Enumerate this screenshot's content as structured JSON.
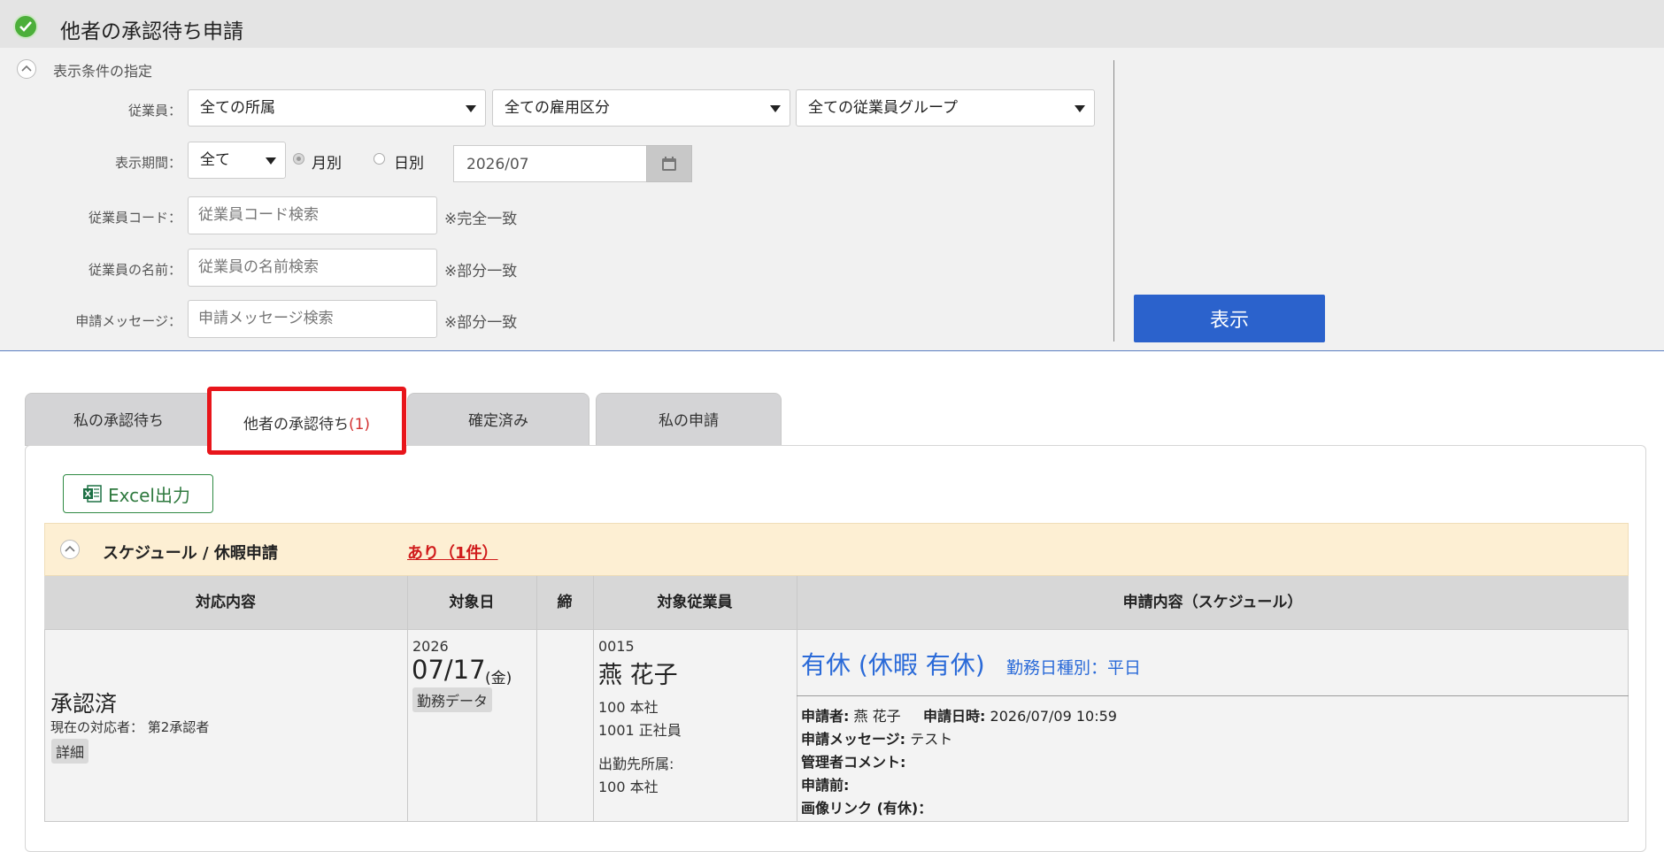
{
  "header": {
    "title": "他者の承認待ち申請",
    "icon": "check-circle-icon"
  },
  "filter": {
    "section_label": "表示条件の指定",
    "employee_label": "従業員：",
    "employee_selects": [
      "全ての所属",
      "全ての雇用区分",
      "全ての従業員グループ"
    ],
    "period_label": "表示期間：",
    "period_select": "全て",
    "radio_monthly": "月別",
    "radio_daily": "日別",
    "date_value": "2026/07",
    "code_label": "従業員コード：",
    "code_placeholder": "従業員コード検索",
    "code_note": "※完全一致",
    "name_label": "従業員の名前：",
    "name_placeholder": "従業員の名前検索",
    "name_note": "※部分一致",
    "message_label": "申請メッセージ：",
    "message_placeholder": "申請メッセージ検索",
    "message_note": "※部分一致",
    "show_button": "表示"
  },
  "tabs": [
    {
      "label": "私の承認待ち"
    },
    {
      "label": "他者の承認待ち",
      "count": "(1)"
    },
    {
      "label": "確定済み"
    },
    {
      "label": "私の申請"
    }
  ],
  "excel_button": "Excel出力",
  "schedule": {
    "title": "スケジュール / 休暇申請",
    "link": "あり（1件）"
  },
  "table": {
    "headers": [
      "対応内容",
      "対象日",
      "締",
      "対象従業員",
      "申請内容（スケジュール）"
    ],
    "row": {
      "status": "承認済",
      "current_handler": "現在の対応者： 第2承認者",
      "detail_button": "詳細",
      "year": "2026",
      "date": "07/17",
      "dow": "(金)",
      "work_data": "勤務データ",
      "emp_code": "0015",
      "emp_name": "燕 花子",
      "dept": "100 本社",
      "emp_type": "1001 正社員",
      "work_dest_label": "出勤先所属:",
      "work_dest": "100  本社",
      "request_title": "有休 (休暇 有休)",
      "day_type": "勤務日種別：平日",
      "applicant_label": "申請者:",
      "applicant": "燕 花子",
      "applied_label": "申請日時:",
      "applied_at": "2026/07/09 10:59",
      "message_label": "申請メッセージ:",
      "message": "テスト",
      "admin_comment_label": "管理者コメント:",
      "before_label": "申請前:",
      "image_link_label": "画像リンク (有休)："
    }
  }
}
